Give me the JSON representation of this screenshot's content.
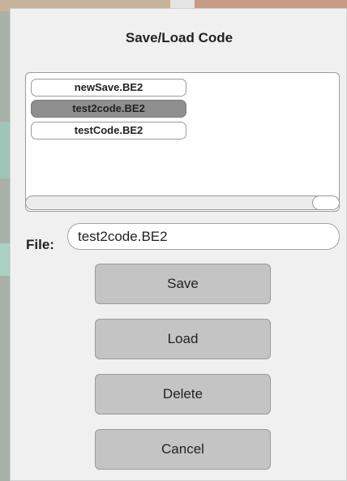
{
  "dialog": {
    "title": "Save/Load Code"
  },
  "file_list": {
    "items": [
      {
        "name": "newSave.BE2",
        "selected": false
      },
      {
        "name": "test2code.BE2",
        "selected": true
      },
      {
        "name": "testCode.BE2",
        "selected": false
      }
    ]
  },
  "file_field": {
    "label": "File:",
    "value": "test2code.BE2"
  },
  "buttons": {
    "save": "Save",
    "load": "Load",
    "delete": "Delete",
    "cancel": "Cancel"
  },
  "colors": {
    "dialog_bg": "#f0f0f0",
    "selected_item": "#8f8f8f",
    "button_bg": "#c4c4c4"
  }
}
